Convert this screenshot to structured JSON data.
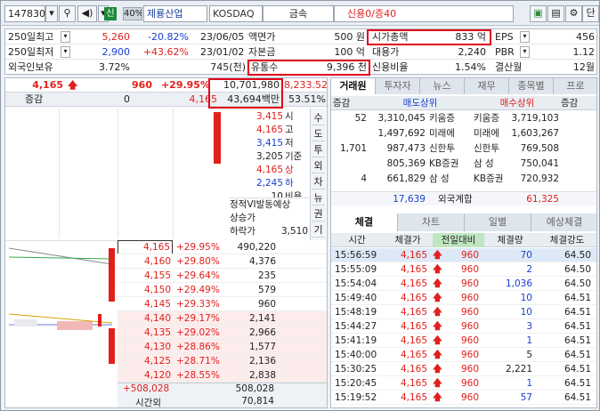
{
  "toolbar": {
    "code": "147830",
    "market": "KOSDAQ",
    "sector": "금속",
    "credit": "신용0/증40",
    "badge_sin": "신",
    "badge_40": "40%",
    "name": "제룡산업",
    "right_btn": "단"
  },
  "info": {
    "r1": {
      "l1": "250일최고",
      "v1": "5,260",
      "p1": "-20.82%",
      "d1": "23/06/05",
      "l2": "액면가",
      "v2": "500 원",
      "l3": "시가총액",
      "v3": "833 억",
      "l4": "EPS",
      "v4": "456"
    },
    "r2": {
      "l1": "250일최저",
      "v1": "2,900",
      "p1": "+43.62%",
      "d1": "23/01/02",
      "l2": "자본금",
      "v2": "100 억",
      "l3": "대용가",
      "v3": "2,240",
      "l4": "PBR",
      "v4": "1.12"
    },
    "r3": {
      "l1": "외국인보유",
      "v1": "3.72%",
      "v2": "745(천)",
      "l3": "유통수",
      "v3": "9,396 천",
      "l3b": "신용비율",
      "v3b": "1.54%",
      "l4": "결산월",
      "v4": "12월"
    }
  },
  "quote": {
    "price": "4,165",
    "change": "960",
    "rate": "+29.95%",
    "volume": "10,701,980",
    "vol2": "8,233.52",
    "amount": "43,694백만",
    "ratio": "53.51%",
    "label_jg": "증감",
    "jg_val": "0",
    "jg_price": "4,165"
  },
  "summary": [
    {
      "v": "3,415",
      "k": "시"
    },
    {
      "v": "4,165",
      "k": "고"
    },
    {
      "v": "3,415",
      "k": "저"
    },
    {
      "v": "3,205",
      "k": "기준"
    },
    {
      "v": "4,165",
      "k": "상"
    },
    {
      "v": "2,245",
      "k": "하"
    },
    {
      "v": "10",
      "k": "비용"
    }
  ],
  "side_tabs": [
    "수",
    "도",
    "투",
    "외",
    "차",
    "뉴",
    "권",
    "기"
  ],
  "vi": {
    "title": "정적VI발동예상",
    "up": "상승가",
    "down": "하락가",
    "down_v": "3,510"
  },
  "asks": [
    {
      "p": "4,165",
      "r": "+29.95%",
      "q": "490,220"
    },
    {
      "p": "4,160",
      "r": "+29.80%",
      "q": "4,376"
    },
    {
      "p": "4,155",
      "r": "+29.64%",
      "q": "235"
    },
    {
      "p": "4,150",
      "r": "+29.49%",
      "q": "579"
    },
    {
      "p": "4,145",
      "r": "+29.33%",
      "q": "960"
    },
    {
      "p": "4,140",
      "r": "+29.17%",
      "q": "2,141"
    },
    {
      "p": "4,135",
      "r": "+29.02%",
      "q": "2,966"
    },
    {
      "p": "4,130",
      "r": "+28.86%",
      "q": "1,577"
    },
    {
      "p": "4,125",
      "r": "+28.71%",
      "q": "2,136"
    },
    {
      "p": "4,120",
      "r": "+28.55%",
      "q": "2,838"
    }
  ],
  "bottom": {
    "left": "+508,028",
    "right": "508,028",
    "label": "시간외",
    "val": "70,814"
  },
  "broker_tabs": [
    "거래원",
    "투자자",
    "뉴스",
    "재무",
    "종목별",
    "프로"
  ],
  "broker_head": {
    "c1": "증감",
    "c2": "매도상위",
    "c3": "매수상위",
    "c4": "증감"
  },
  "brokers": [
    {
      "j": "52",
      "sq": "3,310,045",
      "sn": "키움증",
      "bn": "키움증",
      "bq": "3,719,103",
      "bj": ""
    },
    {
      "j": "",
      "sq": "1,497,692",
      "sn": "미래에",
      "bn": "미래에",
      "bq": "1,603,267",
      "bj": ""
    },
    {
      "j": "1,701",
      "sq": "987,473",
      "sn": "신한투",
      "bn": "신한투",
      "bq": "769,508",
      "bj": ""
    },
    {
      "j": "",
      "sq": "805,369",
      "sn": "KB증권",
      "bn": "삼 성",
      "bq": "750,041",
      "bj": ""
    },
    {
      "j": "4",
      "sq": "661,829",
      "sn": "삼 성",
      "bn": "KB증권",
      "bq": "720,932",
      "bj": ""
    }
  ],
  "foreign": {
    "s": "17,639",
    "l": "외국계합",
    "b": "61,325"
  },
  "trade_tabs": [
    "체결",
    "차트",
    "일별",
    "예상체결"
  ],
  "trade_head": {
    "t": "시간",
    "p": "체결가",
    "d": "전일대비",
    "q": "체결량",
    "s": "체결강도"
  },
  "trades": [
    {
      "t": "15:56:59",
      "p": "4,165",
      "d": "960",
      "q": "70",
      "s": "64.50"
    },
    {
      "t": "15:55:09",
      "p": "4,165",
      "d": "960",
      "q": "2",
      "s": "64.50"
    },
    {
      "t": "15:54:04",
      "p": "4,165",
      "d": "960",
      "q": "1,036",
      "s": "64.50"
    },
    {
      "t": "15:49:40",
      "p": "4,165",
      "d": "960",
      "q": "10",
      "s": "64.51"
    },
    {
      "t": "15:48:19",
      "p": "4,165",
      "d": "960",
      "q": "10",
      "s": "64.51"
    },
    {
      "t": "15:44:27",
      "p": "4,165",
      "d": "960",
      "q": "3",
      "s": "64.51"
    },
    {
      "t": "15:41:19",
      "p": "4,165",
      "d": "960",
      "q": "1",
      "s": "64.51"
    },
    {
      "t": "15:40:00",
      "p": "4,165",
      "d": "960",
      "q": "5",
      "s": "64.51"
    },
    {
      "t": "15:30:25",
      "p": "4,165",
      "d": "960",
      "q": "2,221",
      "s": "64.51"
    },
    {
      "t": "15:20:45",
      "p": "4,165",
      "d": "960",
      "q": "1",
      "s": "64.51"
    },
    {
      "t": "15:19:52",
      "p": "4,165",
      "d": "960",
      "q": "57",
      "s": "64.51"
    }
  ],
  "trade_qty_color": [
    "blue",
    "blue",
    "blue",
    "blue",
    "blue",
    "blue",
    "blue",
    "black",
    "black",
    "blue",
    "blue"
  ]
}
